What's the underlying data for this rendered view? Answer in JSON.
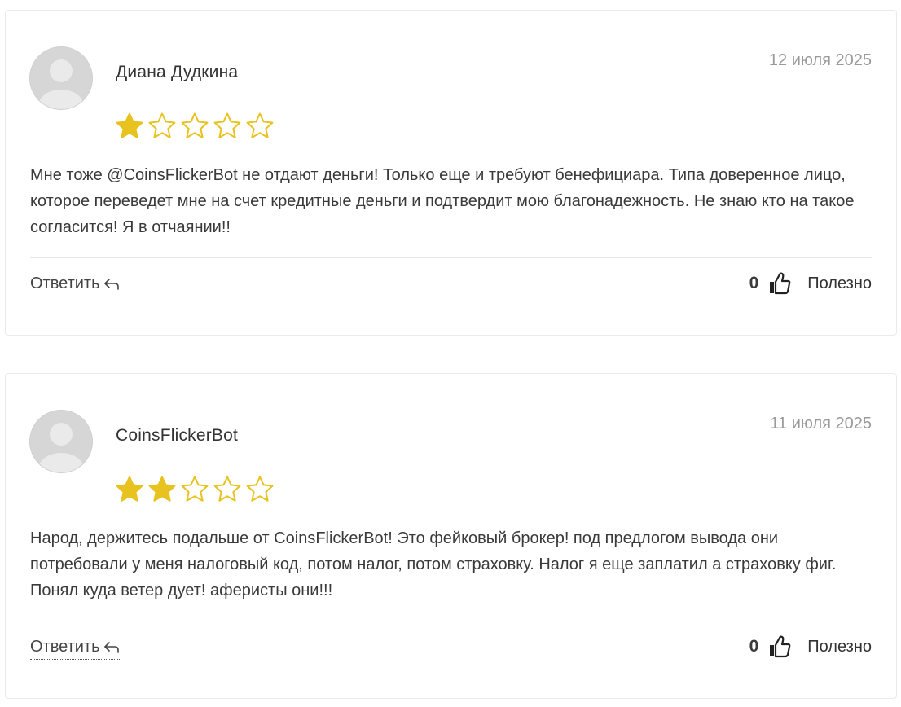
{
  "reviews": [
    {
      "author": "Диана Дудкина",
      "date": "12 июля 2025",
      "rating": 1,
      "max_rating": 5,
      "text": "Мне тоже @CoinsFlickerBot не отдают деньги! Только еще и требуют бенефициара. Типа доверенное лицо, которое переведет мне на счет кредитные деньги и подтвердит мою благонадежность. Не знаю кто на такое согласится! Я в отчаянии!!",
      "reply_label": "Ответить",
      "useful_count": "0",
      "useful_label": "Полезно"
    },
    {
      "author": "CoinsFlickerBot",
      "date": "11 июля 2025",
      "rating": 2,
      "max_rating": 5,
      "text": "Народ, держитесь подальше от CoinsFlickerBot! Это фейковый брокер! под предлогом вывода они потребовали у меня налоговый код, потом налог, потом страховку. Налог я еще заплатил а страховку фиг. Понял куда ветер дует! аферисты они!!!",
      "reply_label": "Ответить",
      "useful_count": "0",
      "useful_label": "Полезно"
    }
  ],
  "icons": {
    "avatar": "default-user-avatar",
    "star_filled": "star-filled-icon",
    "star_empty": "star-outline-icon",
    "reply": "reply-arrow-icon",
    "like": "thumbs-up-icon"
  },
  "colors": {
    "star": "#e8c21e",
    "date": "#9a9a9a",
    "border": "#ebebeb"
  }
}
